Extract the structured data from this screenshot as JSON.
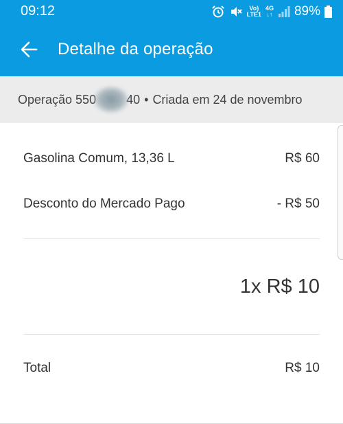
{
  "status_bar": {
    "time": "09:12",
    "battery": "89%",
    "vo_top": "Vo)",
    "vo_bottom": "LTE1",
    "net_top": "4G",
    "net_bottom": "↓↑"
  },
  "header": {
    "title": "Detalhe da operação"
  },
  "operation": {
    "prefix": "Operação 550",
    "suffix": "40",
    "separator": "•",
    "created": "Criada em 24 de novembro"
  },
  "items": [
    {
      "label": "Gasolina Comum, 13,36 L",
      "value": "R$ 60"
    },
    {
      "label": "Desconto do Mercado Pago",
      "value": "- R$ 50"
    }
  ],
  "installments": "1x R$ 10",
  "total": {
    "label": "Total",
    "value": "R$ 10"
  },
  "colors": {
    "brand": "#0a9be0",
    "strip": "#ececec"
  }
}
